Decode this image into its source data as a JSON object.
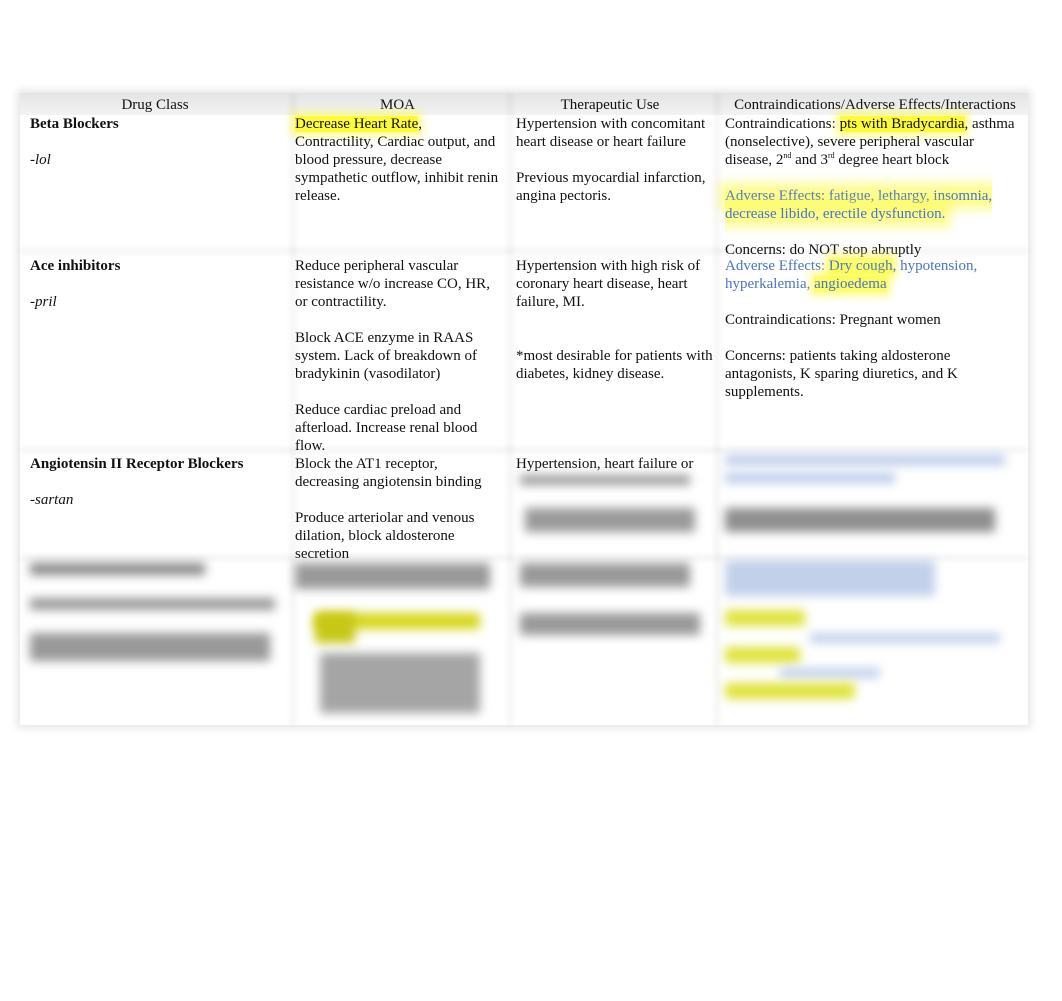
{
  "table": {
    "headers": [
      "Drug Class",
      "MOA",
      "Therapeutic Use",
      "Contraindications/Adverse Effects/Interactions"
    ],
    "rows": [
      {
        "drug_class": "Beta Blockers",
        "suffix": "-lol",
        "moa": {
          "highlight": "Decrease Heart Rate",
          "rest": ", Contractility, Cardiac output, and blood pressure, decrease sympathetic outflow, inhibit renin release."
        },
        "use": [
          "Hypertension with concomitant heart disease or heart failure",
          "Previous myocardial infarction, angina pectoris."
        ],
        "effects": {
          "contra_label": "Contraindications: ",
          "contra_highlight": "pts with Bradycardia",
          "contra_rest_1": ", asthma (nonselective), severe peripheral vascular disease, 2",
          "sup_1": "nd",
          "contra_mid": " and 3",
          "sup_2": "rd",
          "contra_end": " degree heart block",
          "adverse": "Adverse Effects: fatigue, lethargy, insomnia, decrease libido, erectile dysfunction.",
          "concerns": "Concerns: do NOT stop abruptly"
        }
      },
      {
        "drug_class": "Ace inhibitors",
        "suffix": "-pril",
        "moa": [
          "Reduce peripheral vascular resistance w/o increase CO, HR, or contractility.",
          "Block ACE enzyme in RAAS system. Lack of breakdown of bradykinin (vasodilator)",
          "Reduce cardiac preload and afterload. Increase renal blood flow."
        ],
        "use": [
          "Hypertension with high risk of coronary heart disease, heart failure, MI.",
          "*most desirable for patients with diabetes, kidney disease."
        ],
        "effects": {
          "adverse_label": "Adverse Effects: ",
          "adverse_highlight": "Dry cough",
          "adverse_rest": ", hypotension, hyperkalemia, ",
          "adverse_highlight_2": "angioedema",
          "contra": "Contraindications: Pregnant women",
          "concerns": "Concerns: patients taking aldosterone antagonists, K sparing diuretics, and K supplements."
        }
      },
      {
        "drug_class": "Angiotensin II Receptor Blockers",
        "suffix": "-sartan",
        "moa": [
          "Block the AT1 receptor, decreasing angiotensin binding",
          "Produce arteriolar and venous dilation, block aldosterone secretion"
        ],
        "use": [
          "Hypertension, heart failure or"
        ]
      }
    ]
  },
  "colors": {
    "highlight": "#fbfb3c",
    "adverse_text": "#4a74c4",
    "header_bg": "#e8e8e8"
  }
}
